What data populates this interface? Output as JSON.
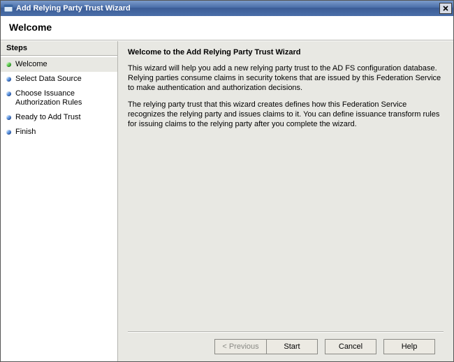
{
  "window": {
    "title": "Add Relying Party Trust Wizard"
  },
  "header": {
    "title": "Welcome"
  },
  "sidebar": {
    "title": "Steps",
    "items": [
      {
        "label": "Welcome",
        "active": true,
        "bullet": "green"
      },
      {
        "label": "Select Data Source",
        "active": false,
        "bullet": "blue"
      },
      {
        "label": "Choose Issuance Authorization Rules",
        "active": false,
        "bullet": "blue"
      },
      {
        "label": "Ready to Add Trust",
        "active": false,
        "bullet": "blue"
      },
      {
        "label": "Finish",
        "active": false,
        "bullet": "blue"
      }
    ]
  },
  "content": {
    "heading": "Welcome to the Add Relying Party Trust Wizard",
    "para1": "This wizard will help you add a new relying party trust to the AD FS configuration database.  Relying parties consume claims in security tokens that are issued by this Federation Service to make authentication and authorization decisions.",
    "para2": "The relying party trust that this wizard creates defines how this Federation Service recognizes the relying party and issues claims to it. You can define issuance transform rules for issuing claims to the relying party after you complete the wizard."
  },
  "buttons": {
    "previous": "< Previous",
    "start": "Start",
    "cancel": "Cancel",
    "help": "Help"
  }
}
